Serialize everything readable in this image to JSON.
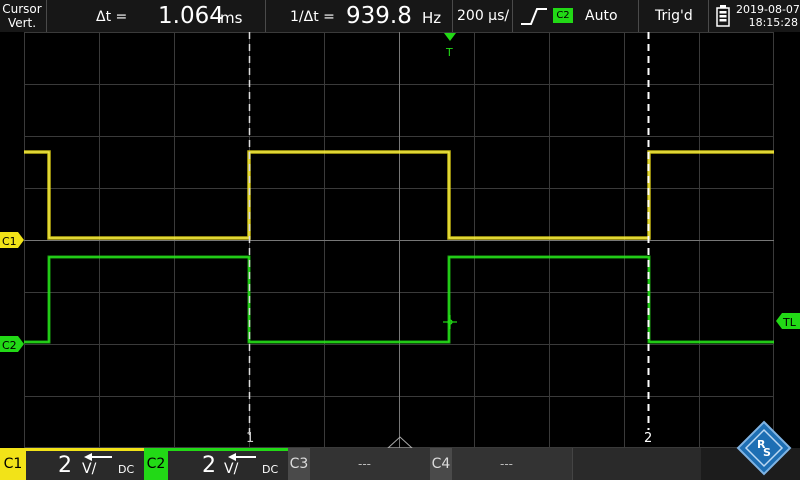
{
  "topbar": {
    "mode_line1": "Cursor",
    "mode_line2": "Vert.",
    "delta_t_label": "Δt =",
    "delta_t_value": "1.064",
    "delta_t_unit": "ms",
    "inv_delta_t_label": "1/Δt =",
    "inv_delta_t_value": "939.8",
    "inv_delta_t_unit": "Hz",
    "timebase": "200 µs/",
    "trigger_source": "C2",
    "trigger_mode": "Auto",
    "trigger_status": "Trig'd",
    "date": "2019-08-07",
    "time": "18:15:28"
  },
  "markers": {
    "ch1": "C1",
    "ch2": "C2",
    "trigger_level": "TL",
    "trigger_top": "T",
    "cursor1": "1",
    "cursor2": "2"
  },
  "channels": [
    {
      "label": "C1",
      "scale_value": "2",
      "scale_unit": "V/",
      "coupling": "DC",
      "color": "#f2e318"
    },
    {
      "label": "C2",
      "scale_value": "2",
      "scale_unit": "V/",
      "coupling": "DC",
      "color": "#22d916"
    },
    {
      "label": "C3",
      "value": "---",
      "color": "#7f7f7f"
    },
    {
      "label": "C4",
      "value": "---",
      "color": "#7f7f7f"
    }
  ],
  "colors": {
    "ch1": "#f2e318",
    "ch2": "#22d916",
    "grid": "#3a3a3a",
    "background": "#000000"
  },
  "icons": [
    "battery-icon",
    "rising-edge-icon",
    "rs-logo-icon"
  ]
}
